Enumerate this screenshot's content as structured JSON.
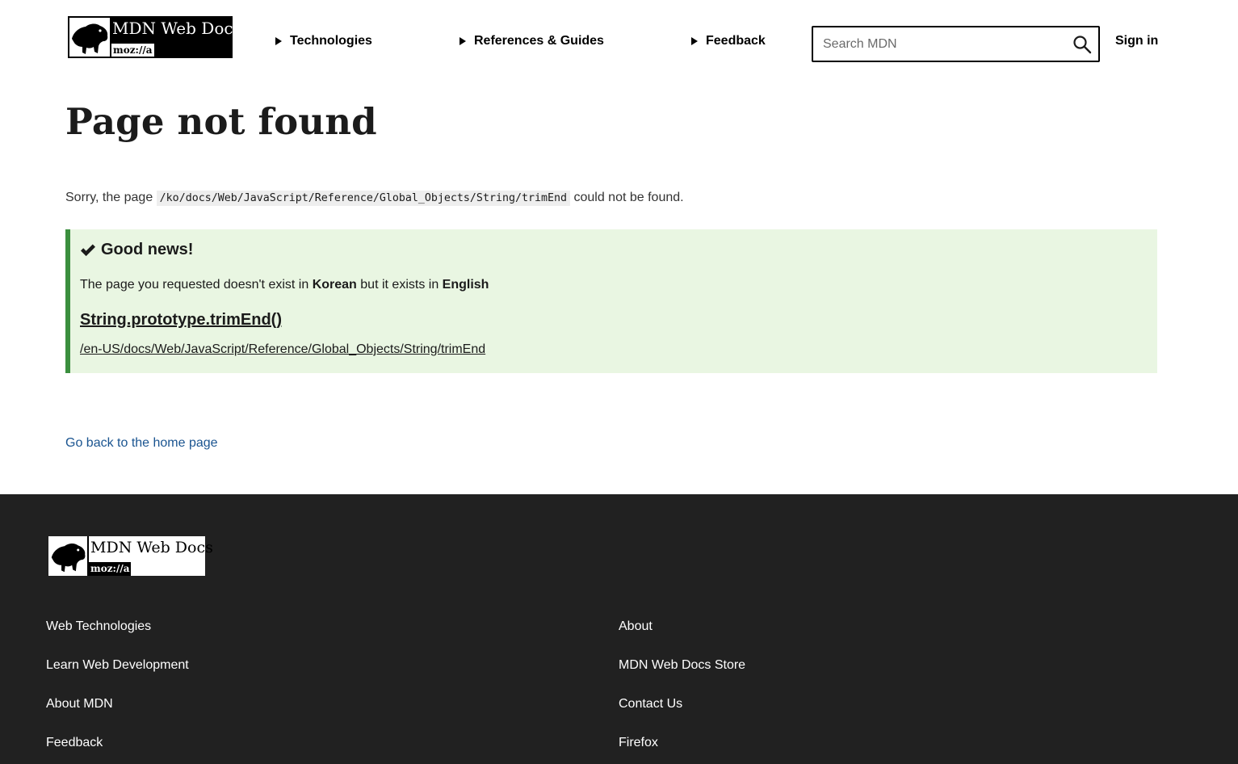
{
  "header": {
    "logo": {
      "brand": "MDN Web Docs",
      "org": "moz://a"
    },
    "nav": [
      {
        "label": "Technologies"
      },
      {
        "label": "References & Guides"
      },
      {
        "label": "Feedback"
      }
    ],
    "search": {
      "placeholder": "Search MDN",
      "value": ""
    },
    "sign_in": "Sign in"
  },
  "main": {
    "title": "Page not found",
    "sorry_prefix": "Sorry, the page",
    "missing_path": "/ko/docs/Web/JavaScript/Reference/Global_Objects/String/trimEnd",
    "sorry_suffix": "could not be found.",
    "notice": {
      "heading": "Good news!",
      "msg_1": "The page you requested doesn't exist in",
      "lang_from": "Korean",
      "msg_2": "but it exists in",
      "lang_to": "English",
      "link_title": "String.prototype.trimEnd()",
      "link_url": "/en-US/docs/Web/JavaScript/Reference/Global_Objects/String/trimEnd"
    },
    "home_link": "Go back to the home page"
  },
  "footer": {
    "logo": {
      "brand": "MDN Web Docs",
      "org": "moz://a"
    },
    "col1": [
      "Web Technologies",
      "Learn Web Development",
      "About MDN",
      "Feedback"
    ],
    "col2": [
      "About",
      "MDN Web Docs Store",
      "Contact Us",
      "Firefox"
    ]
  },
  "colors": {
    "notice_bg": "#e9f6e2",
    "notice_border": "#3b8f3e",
    "link": "#1a5490",
    "footer_bg": "#212121"
  },
  "icons": [
    "dinosaur-logo-icon",
    "triangle-right-icon",
    "search-icon",
    "checkmark-icon"
  ]
}
